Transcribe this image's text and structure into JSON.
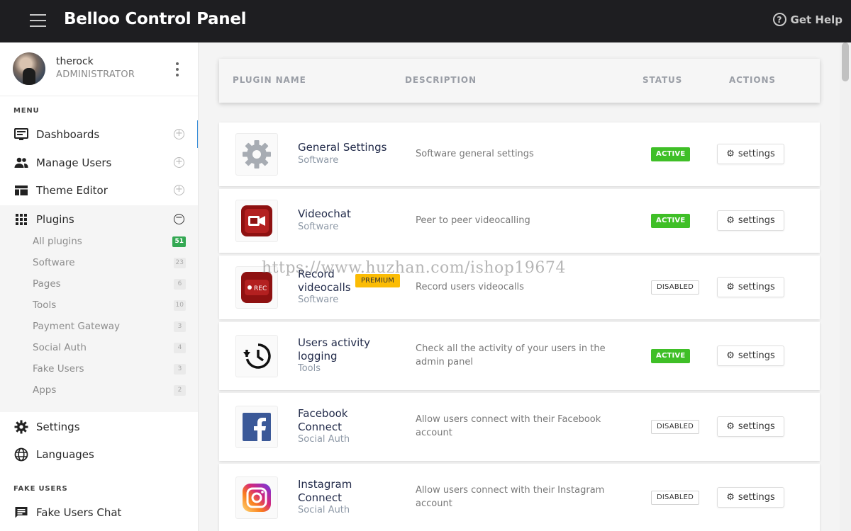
{
  "app": {
    "title": "Belloo Control Panel",
    "help_label": "Get Help"
  },
  "user": {
    "name": "therock",
    "role": "ADMINISTRATOR"
  },
  "sidebar": {
    "menu_label": "MENU",
    "items": [
      {
        "label": "Dashboards",
        "icon": "dashboard-icon"
      },
      {
        "label": "Manage Users",
        "icon": "users-icon"
      },
      {
        "label": "Theme Editor",
        "icon": "theme-icon"
      },
      {
        "label": "Plugins",
        "icon": "grid-icon"
      }
    ],
    "plugin_subitems": [
      {
        "label": "All plugins",
        "count": "51"
      },
      {
        "label": "Software",
        "count": "23"
      },
      {
        "label": "Pages",
        "count": "6"
      },
      {
        "label": "Tools",
        "count": "10"
      },
      {
        "label": "Payment Gateway",
        "count": "3"
      },
      {
        "label": "Social Auth",
        "count": "4"
      },
      {
        "label": "Fake Users",
        "count": "3"
      },
      {
        "label": "Apps",
        "count": "2"
      }
    ],
    "bottom_items": [
      {
        "label": "Settings",
        "icon": "gear-icon"
      },
      {
        "label": "Languages",
        "icon": "globe-icon"
      }
    ],
    "fake_users_label": "FAKE USERS",
    "fake_users_items": [
      {
        "label": "Fake Users Chat",
        "icon": "chat-icon"
      }
    ]
  },
  "table": {
    "headers": {
      "name": "PLUGIN NAME",
      "description": "DESCRIPTION",
      "status": "STATUS",
      "actions": "ACTIONS"
    },
    "action_label": "settings",
    "premium_label": "PREMIUM",
    "rows": [
      {
        "name": "General Settings",
        "category": "Software",
        "description": "Software general settings",
        "status": "ACTIVE",
        "icon": "gear-icon"
      },
      {
        "name": "Videochat",
        "category": "Software",
        "description": "Peer to peer videocalling",
        "status": "ACTIVE",
        "icon": "video-camera-icon"
      },
      {
        "name": "Record videocalls",
        "category": "Software",
        "description": "Record users videocalls",
        "status": "DISABLED",
        "icon": "rec-icon",
        "premium": true
      },
      {
        "name": "Users activity logging",
        "category": "Tools",
        "description": "Check all the activity of your users in the admin panel",
        "status": "ACTIVE",
        "icon": "history-clock-icon"
      },
      {
        "name": "Facebook Connect",
        "category": "Social Auth",
        "description": "Allow users connect with their Facebook account",
        "status": "DISABLED",
        "icon": "facebook-icon"
      },
      {
        "name": "Instagram Connect",
        "category": "Social Auth",
        "description": "Allow users connect with their Instagram account",
        "status": "DISABLED",
        "icon": "instagram-icon"
      }
    ]
  },
  "watermark": "https://www.huzhan.com/ishop19674",
  "colors": {
    "topbar": "#1e1e21",
    "active": "#3fbf27",
    "premium": "#fbbc05",
    "accent_edge": "#3a8fd9"
  }
}
